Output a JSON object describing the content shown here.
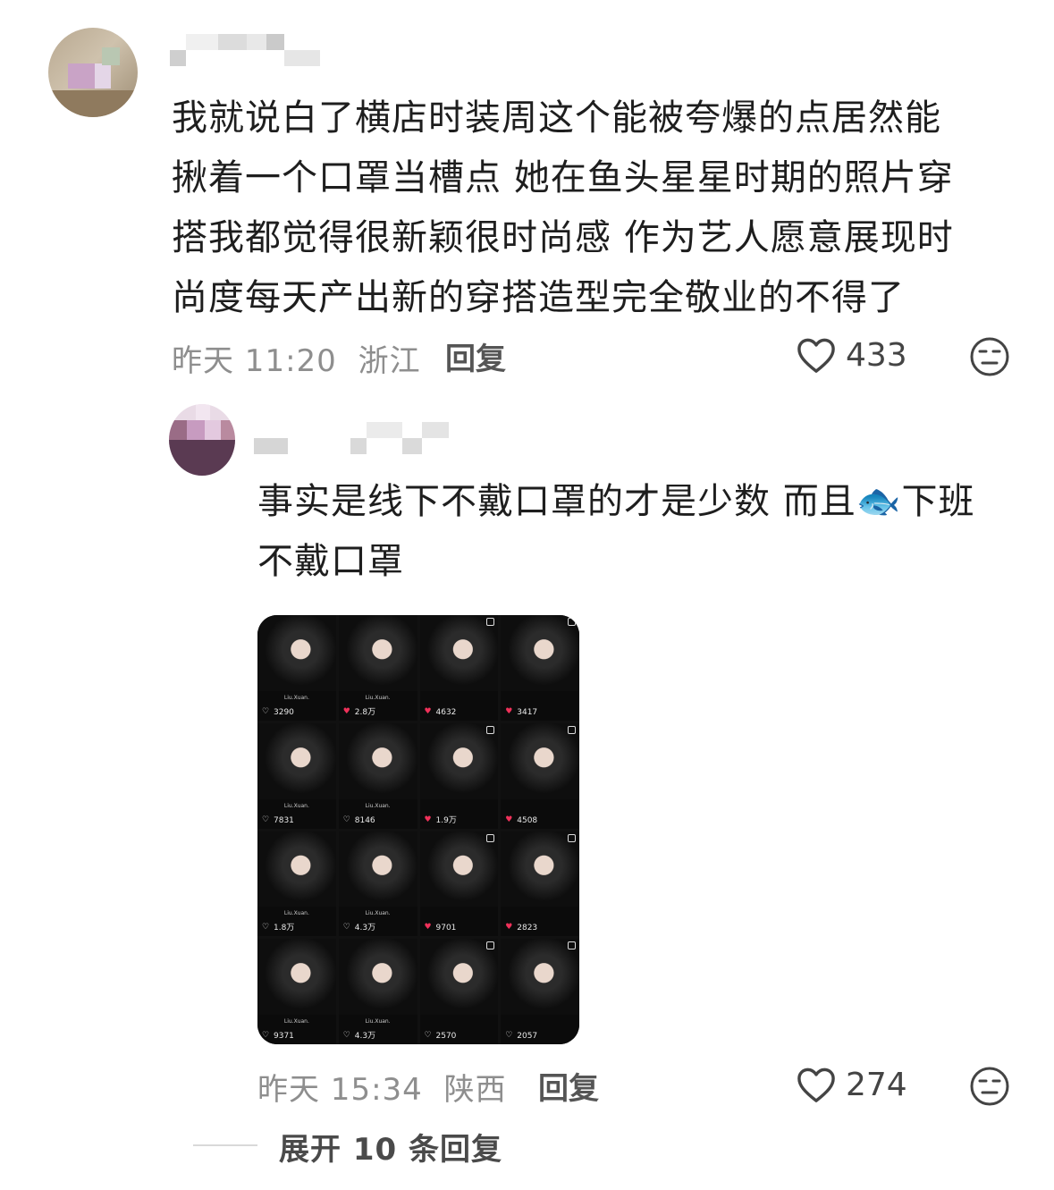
{
  "comments": [
    {
      "text_lines": [
        "我就说白了横店时装周这个能被夸爆的点居然能",
        "揪着一个口罩当槽点 她在鱼头星星时期的照片穿",
        "搭我都觉得很新颖很时尚感 作为艺人愿意展现时",
        "尚度每天产出新的穿搭造型完全敬业的不得了"
      ],
      "time": "昨天 11:20",
      "location": "浙江",
      "reply_label": "回复",
      "likes": "433"
    },
    {
      "text_lines": [
        "事实是线下不戴口罩的才是少数 而且🐟下班",
        "不戴口罩"
      ],
      "time": "昨天 15:34",
      "location": "陕西",
      "reply_label": "回复",
      "likes": "274",
      "image_grid": {
        "brand_text": "Liu.Xuan.",
        "tiles": [
          {
            "count": "3290",
            "liked": false
          },
          {
            "count": "2.8万",
            "liked": true
          },
          {
            "count": "4632",
            "liked": true
          },
          {
            "count": "3417",
            "liked": true
          },
          {
            "count": "7831",
            "liked": false
          },
          {
            "count": "8146",
            "liked": false
          },
          {
            "count": "1.9万",
            "liked": true
          },
          {
            "count": "4508",
            "liked": true
          },
          {
            "count": "1.8万",
            "liked": false
          },
          {
            "count": "4.3万",
            "liked": false
          },
          {
            "count": "9701",
            "liked": true
          },
          {
            "count": "2823",
            "liked": true
          },
          {
            "count": "9371",
            "liked": false
          },
          {
            "count": "4.3万",
            "liked": false
          },
          {
            "count": "2570",
            "liked": false
          },
          {
            "count": "2057",
            "liked": false
          }
        ]
      }
    }
  ],
  "expand_replies": "展开 10 条回复",
  "colors": {
    "heart_red": "#f0315a",
    "meta_gray": "#8e8e8e"
  },
  "icons": {
    "like": "heart-outline-icon",
    "dislike": "meh-face-icon"
  }
}
